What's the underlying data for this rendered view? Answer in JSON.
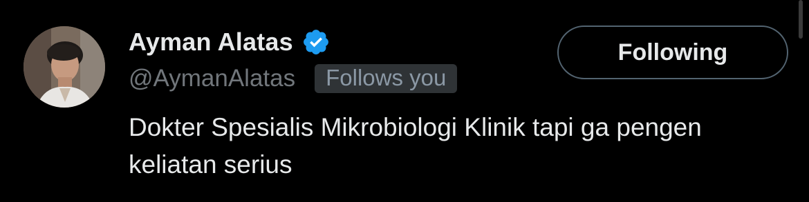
{
  "user": {
    "display_name": "Ayman Alatas",
    "handle": "@AymanAlatas",
    "follows_you_label": "Follows you",
    "bio": "Dokter Spesialis Mikrobiologi Klinik tapi ga pengen keliatan serius",
    "verified": true
  },
  "follow_button": {
    "label": "Following"
  },
  "colors": {
    "background": "#000000",
    "primary_text": "#e7e9ea",
    "secondary_text": "#71767b",
    "verified_badge": "#1d9bf0",
    "button_border": "#536471",
    "badge_background": "#2f3336"
  },
  "icons": {
    "verified": "verified-badge-icon",
    "avatar": "profile-photo"
  }
}
